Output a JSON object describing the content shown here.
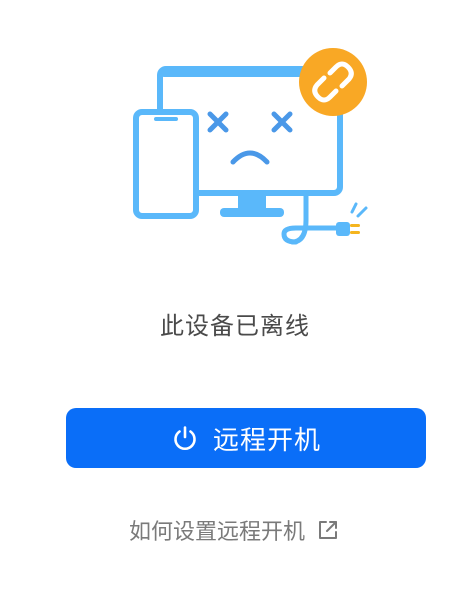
{
  "status": {
    "message": "此设备已离线"
  },
  "actions": {
    "wake_label": "远程开机",
    "help_link_label": "如何设置远程开机"
  },
  "icons": {
    "illustration": "offline-device-illustration",
    "disconnect_badge": "broken-link-icon",
    "power": "power-icon",
    "external_link": "external-link-icon"
  },
  "colors": {
    "primary": "#0a6ef8",
    "illustration_blue": "#5ab8fa",
    "badge_orange": "#f9a825",
    "plug_yellow": "#f5b51e",
    "status_text": "#4a4a4a",
    "link_text": "#7a7a7a"
  }
}
